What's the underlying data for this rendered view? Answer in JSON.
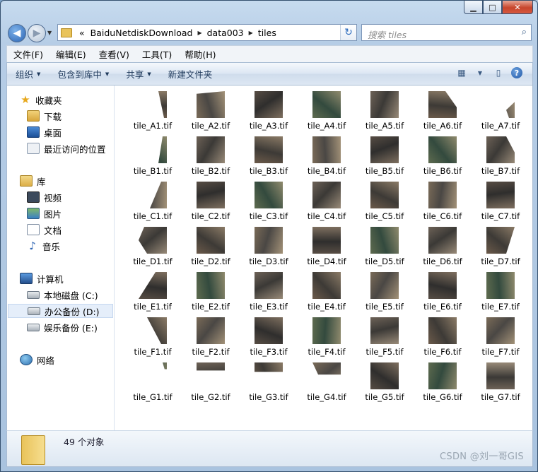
{
  "window": {
    "minimize": "▁",
    "maximize": "□",
    "close": "✕"
  },
  "address": {
    "crumbs_prefix": "«",
    "crumbs": [
      "BaiduNetdiskDownload",
      "data003",
      "tiles"
    ]
  },
  "search": {
    "placeholder": "搜索 tiles"
  },
  "menu": [
    "文件(F)",
    "编辑(E)",
    "查看(V)",
    "工具(T)",
    "帮助(H)"
  ],
  "commands": {
    "organize": "组织",
    "include_library": "包含到库中",
    "share": "共享",
    "new_folder": "新建文件夹"
  },
  "nav": {
    "favorites": "收藏夹",
    "downloads": "下载",
    "desktop": "桌面",
    "recent": "最近访问的位置",
    "libraries": "库",
    "videos": "视频",
    "pictures": "图片",
    "documents": "文档",
    "music": "音乐",
    "computer": "计算机",
    "drive_c": "本地磁盘 (C:)",
    "drive_d": "办公备份 (D:)",
    "drive_e": "娱乐备份 (E:)",
    "network": "网络"
  },
  "files": {
    "rows": [
      "A",
      "B",
      "C",
      "D",
      "E",
      "F",
      "G"
    ],
    "cols": [
      1,
      2,
      3,
      4,
      5,
      6,
      7
    ],
    "names": [
      [
        "tile_A1.tif",
        "tile_A2.tif",
        "tile_A3.tif",
        "tile_A4.tif",
        "tile_A5.tif",
        "tile_A6.tif",
        "tile_A7.tif"
      ],
      [
        "tile_B1.tif",
        "tile_B2.tif",
        "tile_B3.tif",
        "tile_B4.tif",
        "tile_B5.tif",
        "tile_B6.tif",
        "tile_B7.tif"
      ],
      [
        "tile_C1.tif",
        "tile_C2.tif",
        "tile_C3.tif",
        "tile_C4.tif",
        "tile_C5.tif",
        "tile_C6.tif",
        "tile_C7.tif"
      ],
      [
        "tile_D1.tif",
        "tile_D2.tif",
        "tile_D3.tif",
        "tile_D4.tif",
        "tile_D5.tif",
        "tile_D6.tif",
        "tile_D7.tif"
      ],
      [
        "tile_E1.tif",
        "tile_E2.tif",
        "tile_E3.tif",
        "tile_E4.tif",
        "tile_E5.tif",
        "tile_E6.tif",
        "tile_E7.tif"
      ],
      [
        "tile_F1.tif",
        "tile_F2.tif",
        "tile_F3.tif",
        "tile_F4.tif",
        "tile_F5.tif",
        "tile_F6.tif",
        "tile_F7.tif"
      ],
      [
        "tile_G1.tif",
        "tile_G2.tif",
        "tile_G3.tif",
        "tile_G4.tif",
        "tile_G5.tif",
        "tile_G6.tif",
        "tile_G7.tif"
      ]
    ]
  },
  "status": {
    "count": "49 个对象"
  },
  "watermark": "CSDN @刘一哥GIS"
}
